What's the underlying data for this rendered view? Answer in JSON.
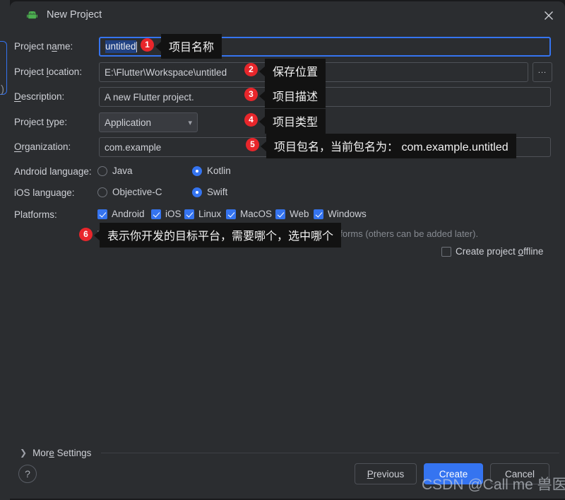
{
  "window": {
    "title": "New Project",
    "icon": "android-robot-icon",
    "close_icon": "close-icon",
    "accent_color": "#3574f0",
    "badge_color": "#e8262b",
    "background_color": "#2b2d30"
  },
  "form": {
    "project_name": {
      "label": "Project name:",
      "label_mnemonic": "a",
      "value": "untitled",
      "selected": true
    },
    "project_location": {
      "label": "Project location:",
      "label_mnemonic": "l",
      "value": "E:\\Flutter\\Workspace\\untitled",
      "browse_label": "..."
    },
    "description": {
      "label": "Description:",
      "label_mnemonic": "D",
      "value": "A new Flutter project."
    },
    "project_type": {
      "label": "Project type:",
      "label_mnemonic": "t",
      "value": "Application",
      "chevron": "chevron-down-icon",
      "options": [
        "Application"
      ]
    },
    "organization": {
      "label": "Organization:",
      "label_mnemonic": "O",
      "value": "com.example"
    },
    "android_language": {
      "label": "Android language:",
      "options": [
        {
          "label": "Java",
          "mnemonic": "J",
          "selected": false
        },
        {
          "label": "Kotlin",
          "mnemonic": "K",
          "selected": true
        }
      ]
    },
    "ios_language": {
      "label": "iOS language:",
      "options": [
        {
          "label": "Objective-C",
          "mnemonic": "C",
          "selected": false
        },
        {
          "label": "Swift",
          "mnemonic": "S",
          "selected": true
        }
      ]
    },
    "platforms": {
      "label": "Platforms:",
      "items": [
        {
          "label": "Android",
          "checked": true
        },
        {
          "label": "iOS",
          "checked": true
        },
        {
          "label": "Linux",
          "checked": true
        },
        {
          "label": "MacOS",
          "checked": true
        },
        {
          "label": "Web",
          "checked": true
        },
        {
          "label": "Windows",
          "checked": true
        }
      ],
      "hint": "When created, the new project will support the selected platforms (others can be added later)."
    },
    "create_offline": {
      "label": "Create project offline",
      "label_mnemonic": "o",
      "checked": false
    }
  },
  "callouts": [
    {
      "number": "1",
      "text": "项目名称"
    },
    {
      "number": "2",
      "text": "保存位置"
    },
    {
      "number": "3",
      "text": "项目描述"
    },
    {
      "number": "4",
      "text": "项目类型"
    },
    {
      "number": "5",
      "text": "项目包名，当前包名为： com.example.untitled"
    },
    {
      "number": "6",
      "text": "表示你开发的目标平台，需要哪个，选中哪个"
    }
  ],
  "footer": {
    "more_settings": "More Settings",
    "more_settings_mnemonic": "e",
    "help_label": "?",
    "previous_label": "Previous",
    "previous_mnemonic": "P",
    "create_label": "Create",
    "cancel_label": "Cancel"
  },
  "watermark": {
    "text": "CSDN @Call me 兽医"
  }
}
